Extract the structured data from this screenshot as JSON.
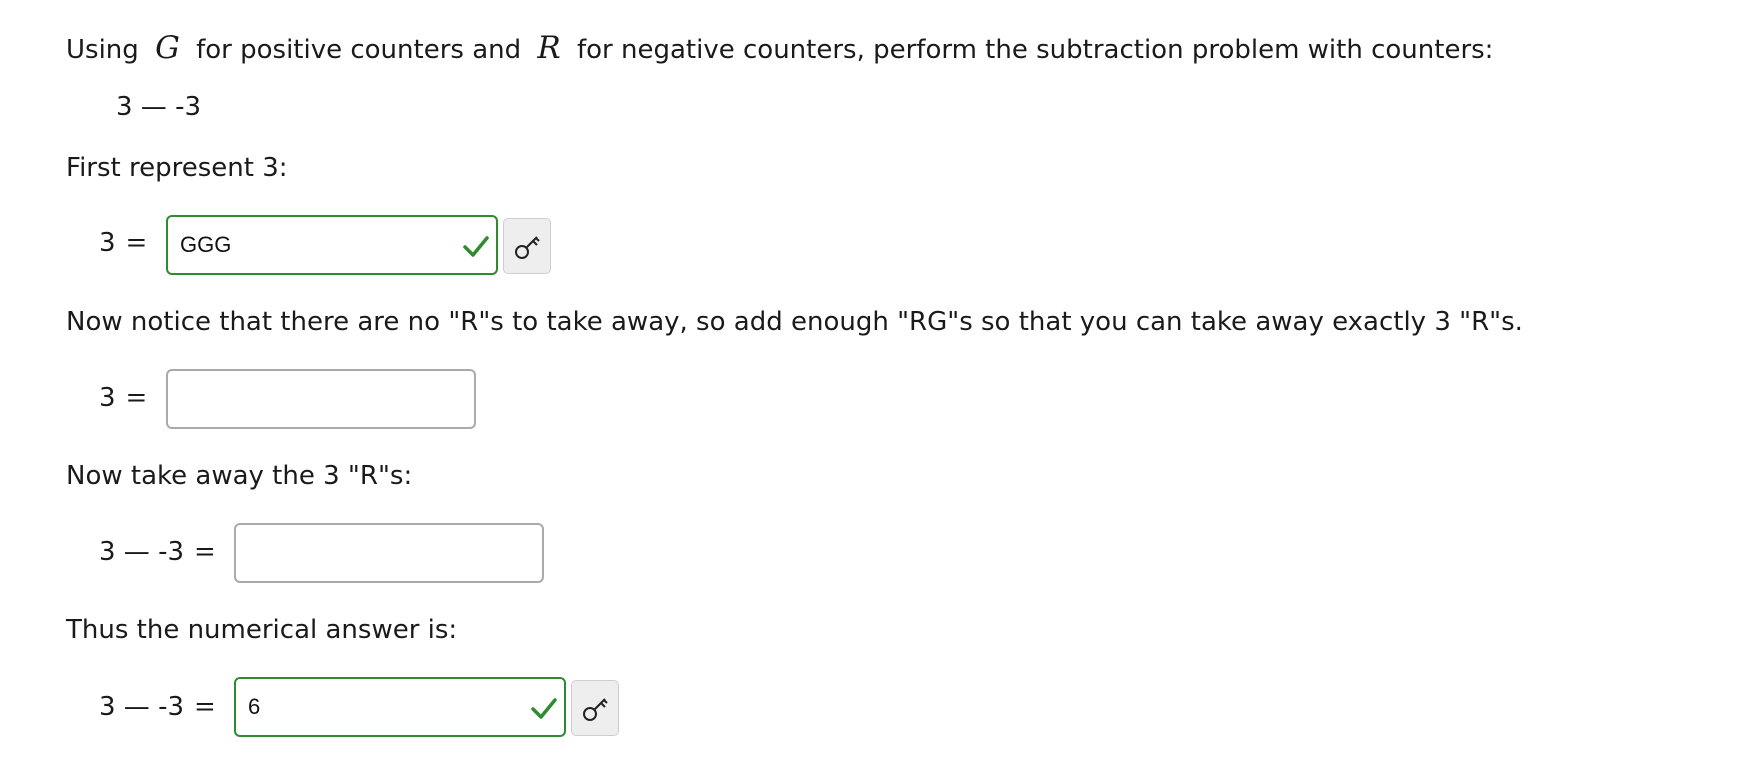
{
  "intro": {
    "text_before": "Using",
    "positive_symbol": "G",
    "text_middle": "for positive counters and",
    "negative_symbol": "R",
    "text_after": "for negative counters, perform the subtraction problem with counters:"
  },
  "problem": "3 — -3",
  "step1": {
    "prompt": "First represent 3:",
    "lhs": "3",
    "eq": "=",
    "input_value": "GGG",
    "status": "correct"
  },
  "step2": {
    "prompt": "Now notice that there are no \"R\"s to take away, so add enough \"RG\"s so that you can take away exactly 3 \"R\"s.",
    "lhs": "3",
    "eq": "=",
    "input_value": ""
  },
  "step3": {
    "prompt": "Now take away the 3 \"R\"s:",
    "lhs": "3 — -3",
    "eq": "=",
    "input_value": ""
  },
  "step4": {
    "prompt": "Thus the numerical answer is:",
    "lhs": "3 — -3",
    "eq": "=",
    "input_value": "6",
    "status": "correct"
  },
  "colors": {
    "correct": "#2e8b2e",
    "neutral_border": "#aaaaaa",
    "key_button_bg": "#eeeeee"
  },
  "icons": {
    "check": "check-icon",
    "answer_key": "key-icon"
  }
}
